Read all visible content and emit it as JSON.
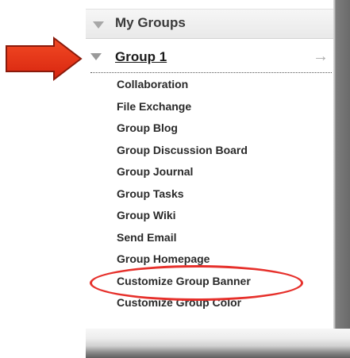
{
  "header": {
    "title": "My Groups"
  },
  "group": {
    "name": "Group 1"
  },
  "menu": {
    "items": [
      "Collaboration",
      "File Exchange",
      "Group Blog",
      "Group Discussion Board",
      "Group Journal",
      "Group Tasks",
      "Group Wiki",
      "Send Email",
      "Group Homepage",
      "Customize Group Banner",
      "Customize Group Color"
    ]
  },
  "colors": {
    "annotation_red": "#e6302b",
    "annotation_arrow_red": "#e8301f"
  },
  "icons": {
    "header_toggle": "collapse-triangle-icon",
    "group_toggle": "collapse-triangle-icon",
    "group_action": "right-arrow-icon",
    "annotation": "red-arrow-annotation"
  }
}
